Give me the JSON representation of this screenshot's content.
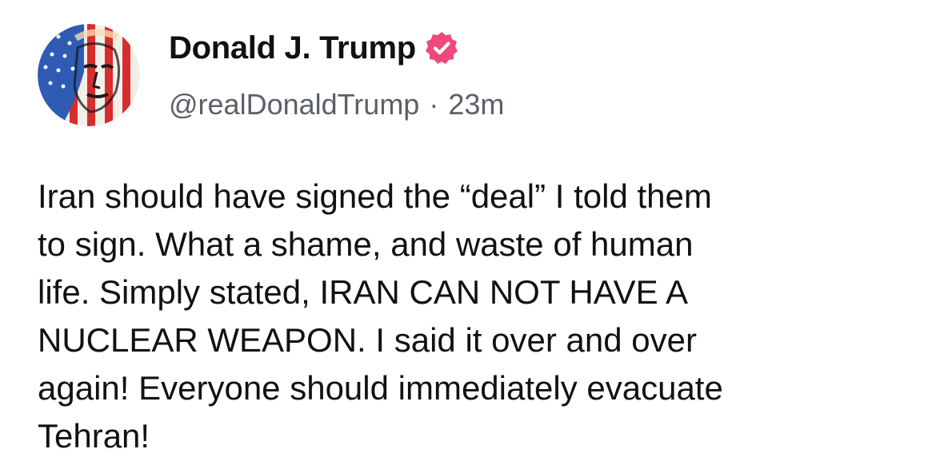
{
  "author": {
    "display_name": "Donald J. Trump",
    "handle": "@realDonaldTrump",
    "separator": "·",
    "timestamp": "23m",
    "verified_icon": "verified-badge-icon",
    "verified_color": "#f0487a",
    "avatar_icon": "portrait-avatar"
  },
  "post": {
    "lines": [
      "Iran should have signed the “deal” I told them",
      "to sign. What a shame, and waste of human",
      "life. Simply stated, IRAN CAN NOT HAVE A",
      "NUCLEAR WEAPON. I said it over and over",
      "again! Everyone should immediately evacuate",
      "Tehran!"
    ]
  }
}
